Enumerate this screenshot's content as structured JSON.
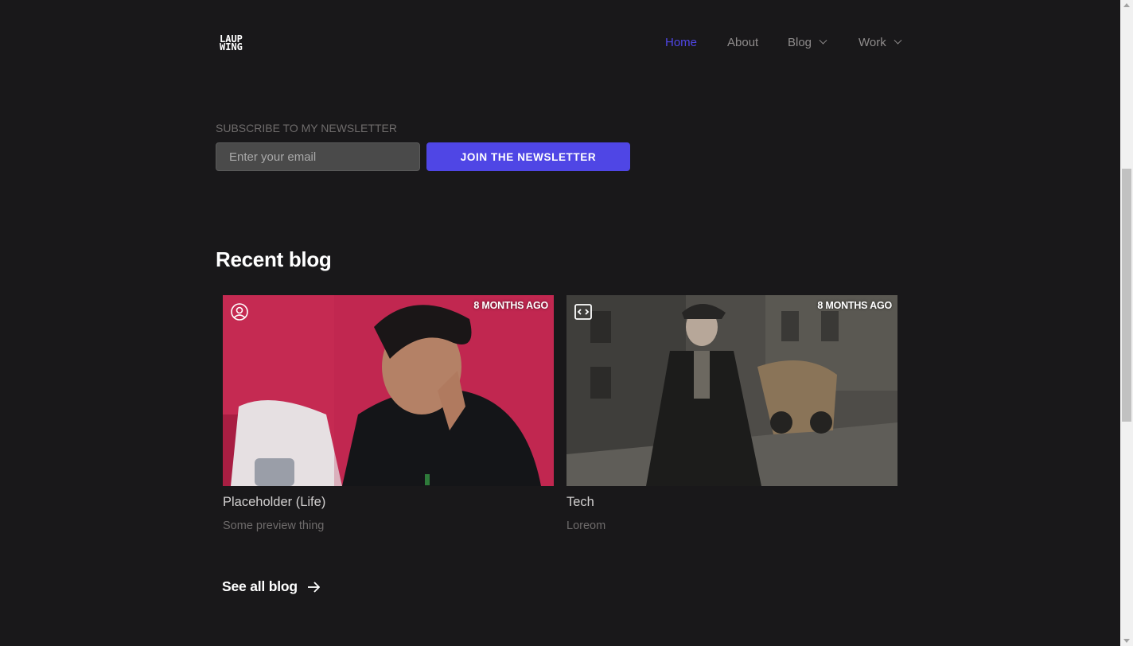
{
  "header": {
    "logo_line1": "LAUP",
    "logo_line2": "WING",
    "nav": [
      {
        "label": "Home",
        "active": true
      },
      {
        "label": "About"
      },
      {
        "label": "Blog",
        "has_dropdown": true
      },
      {
        "label": "Work",
        "has_dropdown": true
      }
    ]
  },
  "newsletter": {
    "label": "SUBSCRIBE TO MY NEWSLETTER",
    "email_placeholder": "Enter your email",
    "email_value": "",
    "button_label": "JOIN THE NEWSLETTER"
  },
  "recent_blog": {
    "title": "Recent blog",
    "posts": [
      {
        "title": "Placeholder (Life)",
        "preview": "Some preview thing",
        "age": "8 MONTHS AGO",
        "category_icon": "user-circle-icon"
      },
      {
        "title": "Tech",
        "preview": "Loreom",
        "age": "8 MONTHS AGO",
        "category_icon": "code-icon"
      }
    ],
    "see_all_label": "See all blog"
  },
  "colors": {
    "background": "#19181a",
    "accent": "#4f46e5",
    "muted_text": "#8f8c8c"
  }
}
